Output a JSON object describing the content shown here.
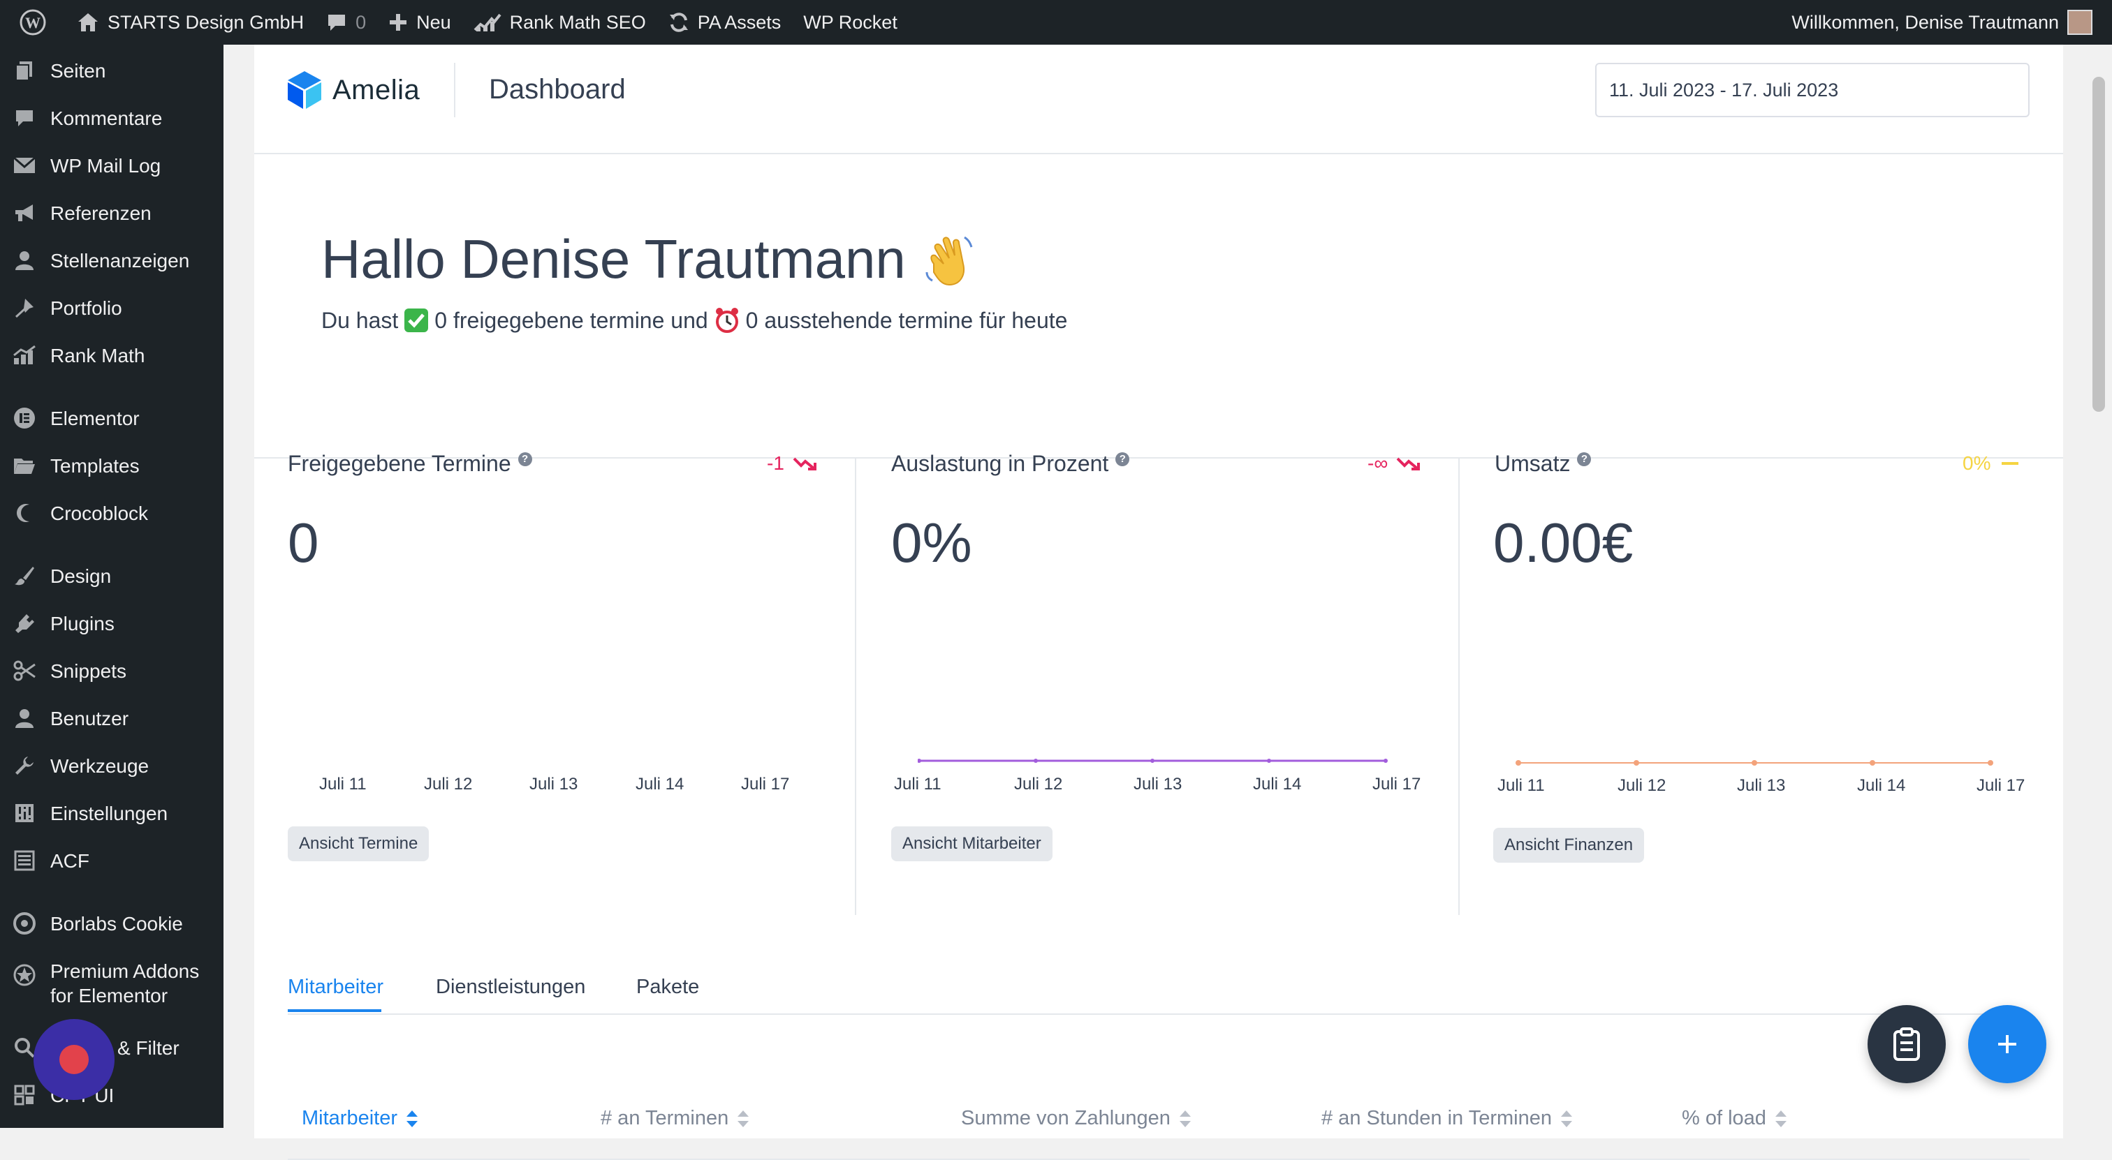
{
  "adminbar": {
    "site_name": "STARTS Design GmbH",
    "comments_count": "0",
    "new_label": "Neu",
    "rankmath_label": "Rank Math SEO",
    "pa_assets_label": "PA Assets",
    "wp_rocket_label": "WP Rocket",
    "greeting": "Willkommen, Denise Trautmann"
  },
  "sidebar": {
    "items": [
      {
        "label": "Seiten",
        "icon": "pages-icon"
      },
      {
        "label": "Kommentare",
        "icon": "comments-icon"
      },
      {
        "label": "WP Mail Log",
        "icon": "mail-icon"
      },
      {
        "label": "Referenzen",
        "icon": "megaphone-icon"
      },
      {
        "label": "Stellenanzeigen",
        "icon": "user-icon"
      },
      {
        "label": "Portfolio",
        "icon": "pin-icon"
      },
      {
        "label": "Rank Math",
        "icon": "rankmath-icon"
      },
      {
        "label": "Elementor",
        "icon": "elementor-icon"
      },
      {
        "label": "Templates",
        "icon": "folder-icon"
      },
      {
        "label": "Crocoblock",
        "icon": "crocoblock-icon"
      },
      {
        "label": "Design",
        "icon": "brush-icon"
      },
      {
        "label": "Plugins",
        "icon": "plugin-icon"
      },
      {
        "label": "Snippets",
        "icon": "scissors-icon"
      },
      {
        "label": "Benutzer",
        "icon": "user-icon"
      },
      {
        "label": "Werkzeuge",
        "icon": "wrench-icon"
      },
      {
        "label": "Einstellungen",
        "icon": "settings-icon"
      },
      {
        "label": "ACF",
        "icon": "grid-icon"
      },
      {
        "label": "Borlabs Cookie",
        "icon": "cookie-icon"
      },
      {
        "label": "Premium Addons for Elementor",
        "icon": "star-icon"
      },
      {
        "label": "& Filter",
        "icon": "search-icon"
      },
      {
        "label": "CPT UI",
        "icon": "cpt-icon"
      }
    ]
  },
  "header": {
    "logo_text": "Amelia",
    "title": "Dashboard",
    "date_range": "11. Juli 2023 - 17. Juli 2023"
  },
  "welcome": {
    "greeting": "Hallo Denise Trautmann",
    "line_prefix": "Du hast",
    "approved_text": "0 freigegebene termine und",
    "pending_text": "0 ausstehende termine für heute"
  },
  "stats": [
    {
      "title": "Freigegebene Termine",
      "trend": "-1",
      "trend_color": "#e5245e",
      "value": "0",
      "button": "Ansicht Termine",
      "x_labels": [
        "Juli 11",
        "Juli 12",
        "Juli 13",
        "Juli 14",
        "Juli 17"
      ]
    },
    {
      "title": "Auslastung in Prozent",
      "trend": "-∞",
      "trend_color": "#e5245e",
      "value": "0%",
      "button": "Ansicht Mitarbeiter",
      "x_labels": [
        "Juli 11",
        "Juli 12",
        "Juli 13",
        "Juli 14",
        "Juli 17"
      ],
      "line_color": "#a25ddc"
    },
    {
      "title": "Umsatz",
      "trend": "0%",
      "trend_color": "#f5d442",
      "value": "0.00€",
      "button": "Ansicht Finanzen",
      "x_labels": [
        "Juli 11",
        "Juli 12",
        "Juli 13",
        "Juli 14",
        "Juli 17"
      ],
      "line_color": "#f3a37b"
    }
  ],
  "tabs": {
    "items": [
      "Mitarbeiter",
      "Dienstleistungen",
      "Pakete"
    ],
    "active": "Mitarbeiter"
  },
  "table": {
    "columns": [
      "Mitarbeiter",
      "# an Terminen",
      "Summe von Zahlungen",
      "# an Stunden in Terminen",
      "% of load"
    ]
  },
  "colors": {
    "accent": "#1a84ee",
    "admin_bar": "#1d2327",
    "negative": "#e5245e",
    "neutral_trend": "#f5d442"
  }
}
